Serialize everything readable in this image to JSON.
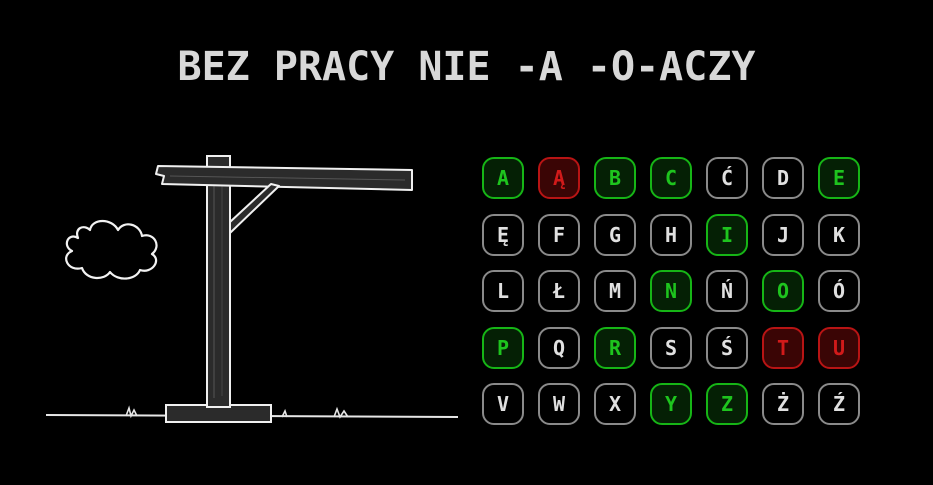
{
  "game": {
    "phrase": "BEZ PRACY NIE -A -O-ACZY"
  },
  "keyboard": {
    "keys": [
      {
        "letter": "A",
        "state": "correct"
      },
      {
        "letter": "Ą",
        "state": "wrong"
      },
      {
        "letter": "B",
        "state": "correct"
      },
      {
        "letter": "C",
        "state": "correct"
      },
      {
        "letter": "Ć",
        "state": "unused"
      },
      {
        "letter": "D",
        "state": "unused"
      },
      {
        "letter": "E",
        "state": "correct"
      },
      {
        "letter": "Ę",
        "state": "unused"
      },
      {
        "letter": "F",
        "state": "unused"
      },
      {
        "letter": "G",
        "state": "unused"
      },
      {
        "letter": "H",
        "state": "unused"
      },
      {
        "letter": "I",
        "state": "correct"
      },
      {
        "letter": "J",
        "state": "unused"
      },
      {
        "letter": "K",
        "state": "unused"
      },
      {
        "letter": "L",
        "state": "unused"
      },
      {
        "letter": "Ł",
        "state": "unused"
      },
      {
        "letter": "M",
        "state": "unused"
      },
      {
        "letter": "N",
        "state": "correct"
      },
      {
        "letter": "Ń",
        "state": "unused"
      },
      {
        "letter": "O",
        "state": "correct"
      },
      {
        "letter": "Ó",
        "state": "unused"
      },
      {
        "letter": "P",
        "state": "correct"
      },
      {
        "letter": "Q",
        "state": "unused"
      },
      {
        "letter": "R",
        "state": "correct"
      },
      {
        "letter": "S",
        "state": "unused"
      },
      {
        "letter": "Ś",
        "state": "unused"
      },
      {
        "letter": "T",
        "state": "wrong"
      },
      {
        "letter": "U",
        "state": "wrong"
      },
      {
        "letter": "V",
        "state": "unused"
      },
      {
        "letter": "W",
        "state": "unused"
      },
      {
        "letter": "X",
        "state": "unused"
      },
      {
        "letter": "Y",
        "state": "correct"
      },
      {
        "letter": "Z",
        "state": "correct"
      },
      {
        "letter": "Ż",
        "state": "unused"
      },
      {
        "letter": "Ź",
        "state": "unused"
      }
    ]
  },
  "colors": {
    "correct": "#16b516",
    "wrong": "#b81414",
    "unused": "#8a8a8a",
    "background": "#000000"
  }
}
